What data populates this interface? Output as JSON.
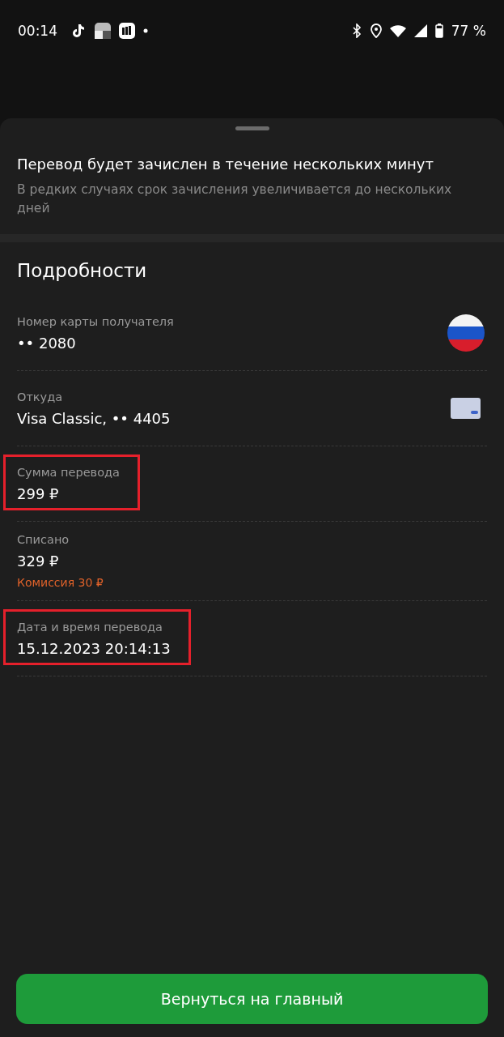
{
  "status_bar": {
    "time": "00:14",
    "battery": "77 %"
  },
  "notice": {
    "title": "Перевод будет зачислен в течение нескольких минут",
    "subtitle": "В редких случаях срок зачисления увеличивается до нескольких дней"
  },
  "details": {
    "title": "Подробности",
    "rows": [
      {
        "label": "Номер карты получателя",
        "value": "•• 2080",
        "kind": "flag",
        "highlighted": false
      },
      {
        "label": "Откуда",
        "value": "Visa Classic, •• 4405",
        "kind": "card",
        "highlighted": false
      },
      {
        "label": "Сумма перевода",
        "value": "299 ₽",
        "highlighted": true
      },
      {
        "label": "Списано",
        "value": "329 ₽",
        "note": "Комиссия 30 ₽",
        "highlighted": false
      },
      {
        "label": "Дата и время перевода",
        "value": "15.12.2023 20:14:13",
        "highlighted": true
      }
    ]
  },
  "button": {
    "label": "Вернуться на главный"
  }
}
